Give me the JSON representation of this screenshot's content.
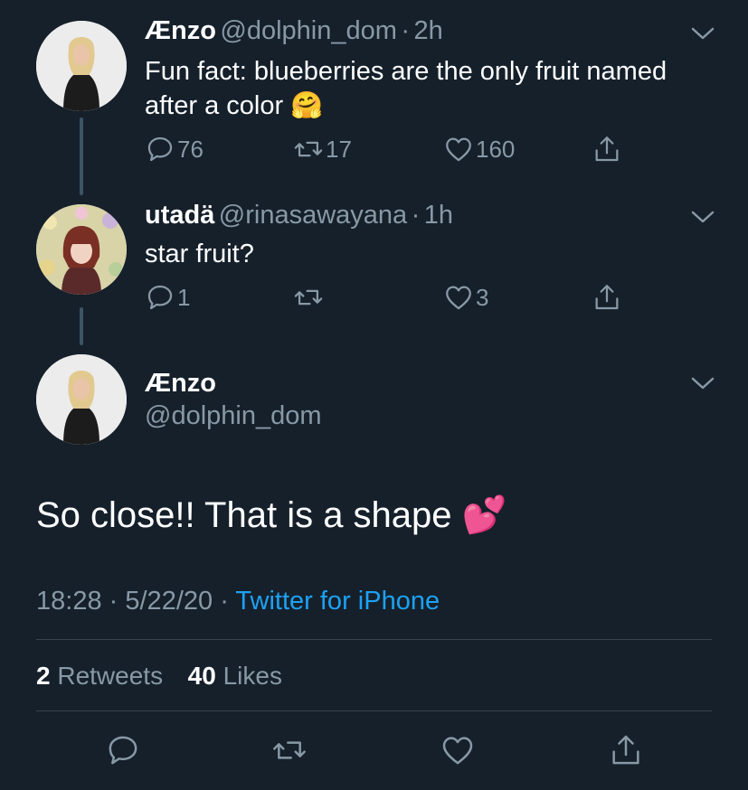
{
  "tweet1": {
    "name": "Ænzo",
    "handle": "@dolphin_dom",
    "sep": "·",
    "time": "2h",
    "text": "Fun fact: blueberries are the only fruit named after a color",
    "emoji": "🤗",
    "replies": "76",
    "retweets": "17",
    "likes": "160"
  },
  "tweet2": {
    "name": "utadä",
    "handle": "@rinasawayana",
    "sep": "·",
    "time": "1h",
    "text": "star fruit?",
    "replies": "1",
    "retweets": "",
    "likes": "3"
  },
  "main": {
    "name": "Ænzo",
    "handle": "@dolphin_dom",
    "text": "So close!! That is a shape",
    "emoji": "💕",
    "time": "18:28",
    "sep1": "·",
    "date": "5/22/20",
    "sep2": "·",
    "source": "Twitter for iPhone",
    "retweets_count": "2",
    "retweets_label": "Retweets",
    "likes_count": "40",
    "likes_label": "Likes"
  },
  "icons": {
    "reply": "reply-icon",
    "retweet": "retweet-icon",
    "like": "heart-icon",
    "share": "share-icon",
    "more": "chevron-down-icon"
  },
  "colors": {
    "background": "#15202b",
    "secondary_text": "#8899a6",
    "link": "#1da1f2",
    "divider": "#38444d"
  }
}
